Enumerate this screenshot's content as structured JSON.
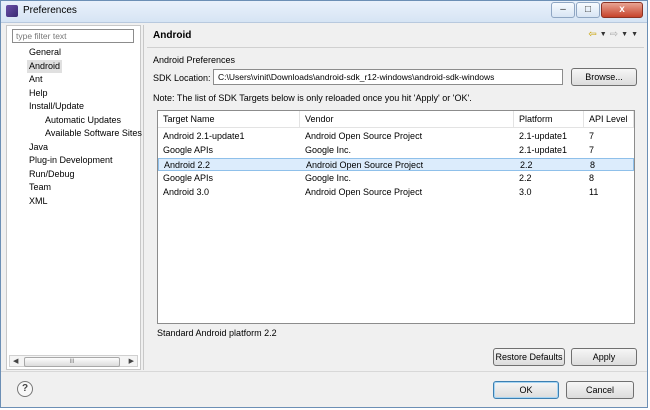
{
  "window": {
    "title": "Preferences",
    "controls": {
      "minimize": "–",
      "maximize": "□",
      "close": "x"
    }
  },
  "sidebar": {
    "filter_placeholder": "type filter text",
    "items": [
      {
        "label": "General",
        "indent": 0
      },
      {
        "label": "Android",
        "indent": 0,
        "selected": true
      },
      {
        "label": "Ant",
        "indent": 0
      },
      {
        "label": "Help",
        "indent": 0
      },
      {
        "label": "Install/Update",
        "indent": 0
      },
      {
        "label": "Automatic Updates",
        "indent": 1
      },
      {
        "label": "Available Software Sites",
        "indent": 1
      },
      {
        "label": "Java",
        "indent": 0
      },
      {
        "label": "Plug-in Development",
        "indent": 0
      },
      {
        "label": "Run/Debug",
        "indent": 0
      },
      {
        "label": "Team",
        "indent": 0
      },
      {
        "label": "XML",
        "indent": 0
      }
    ],
    "scrollbar_grip": "III"
  },
  "page": {
    "title": "Android",
    "section_label": "Android Preferences",
    "sdk_location_label": "SDK Location:",
    "sdk_location_value": "C:\\Users\\vinit\\Downloads\\android-sdk_r12-windows\\android-sdk-windows",
    "browse_label": "Browse...",
    "note": "Note: The list of SDK Targets below is only reloaded once you hit 'Apply' or 'OK'.",
    "table": {
      "columns": [
        "Target Name",
        "Vendor",
        "Platform",
        "API Level"
      ],
      "rows": [
        [
          "Android 2.1-update1",
          "Android Open Source Project",
          "2.1-update1",
          "7"
        ],
        [
          "Google APIs",
          "Google Inc.",
          "2.1-update1",
          "7"
        ],
        [
          "Android 2.2",
          "Android Open Source Project",
          "2.2",
          "8"
        ],
        [
          "Google APIs",
          "Google Inc.",
          "2.2",
          "8"
        ],
        [
          "Android 3.0",
          "Android Open Source Project",
          "3.0",
          "11"
        ]
      ],
      "selected_row": 2
    },
    "description": "Standard Android platform 2.2",
    "restore_defaults_label": "Restore Defaults",
    "apply_label": "Apply"
  },
  "nav_icons": [
    "back-arrow-icon",
    "dropdown-icon",
    "forward-arrow-icon",
    "dropdown-icon",
    "view-menu-icon"
  ],
  "footer": {
    "help_glyph": "?",
    "ok_label": "OK",
    "cancel_label": "Cancel"
  },
  "colors": {
    "selection_row": "#dcecfc",
    "tree_selection": "#e0e0e0",
    "title_gradient": "#d6e4f4",
    "close_button": "#c7432b"
  }
}
